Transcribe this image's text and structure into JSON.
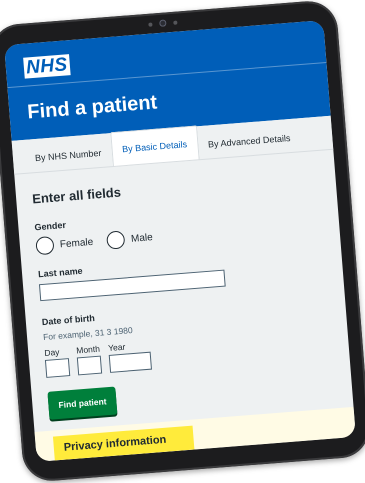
{
  "header": {
    "logo_text": "NHS",
    "page_title": "Find a patient",
    "brand_color": "#005eb8"
  },
  "tabs": [
    {
      "label": "By NHS Number",
      "active": false
    },
    {
      "label": "By Basic Details",
      "active": true
    },
    {
      "label": "By Advanced Details",
      "active": false
    }
  ],
  "form": {
    "heading": "Enter all fields",
    "gender": {
      "label": "Gender",
      "options": [
        "Female",
        "Male"
      ]
    },
    "last_name": {
      "label": "Last name",
      "value": ""
    },
    "dob": {
      "label": "Date of birth",
      "hint": "For example, 31 3 1980",
      "day_label": "Day",
      "month_label": "Month",
      "year_label": "Year"
    },
    "submit_label": "Find patient",
    "submit_color": "#007f3b"
  },
  "privacy": {
    "label": "Privacy information"
  }
}
